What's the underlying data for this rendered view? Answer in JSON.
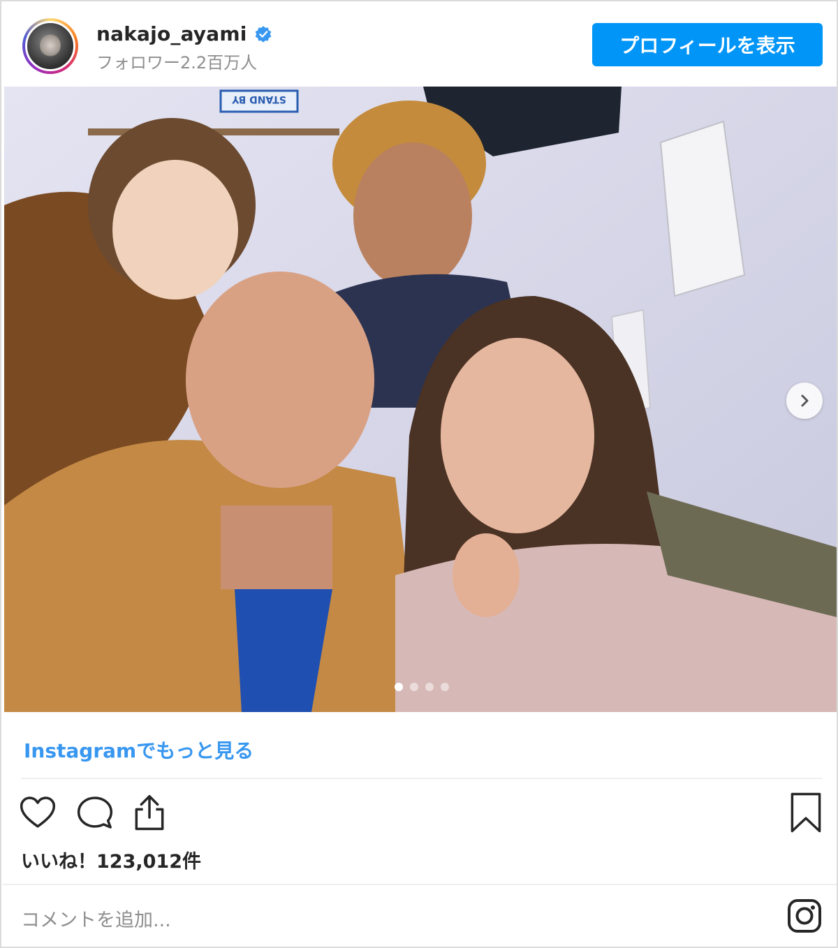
{
  "post": {
    "username": "nakajo_ayami",
    "followers": "フォロワー2.2百万人",
    "profile_button": "プロフィールを表示",
    "more_link": "Instagramでもっと見る",
    "likes": "いいね！123,012件",
    "comment_placeholder": "コメントを追加...",
    "carousel": {
      "slide_count": 4,
      "active_index": 0
    },
    "photo_sign_text": "STAND BY"
  },
  "colors": {
    "primary_button": "#0095f6",
    "link": "#3897f0",
    "verified": "#3897f0",
    "muted_text": "#8e8e8e"
  },
  "icons": [
    "verified-badge-icon",
    "heart-icon",
    "comment-icon",
    "share-icon",
    "bookmark-icon",
    "chevron-right-icon",
    "instagram-glyph-icon"
  ]
}
